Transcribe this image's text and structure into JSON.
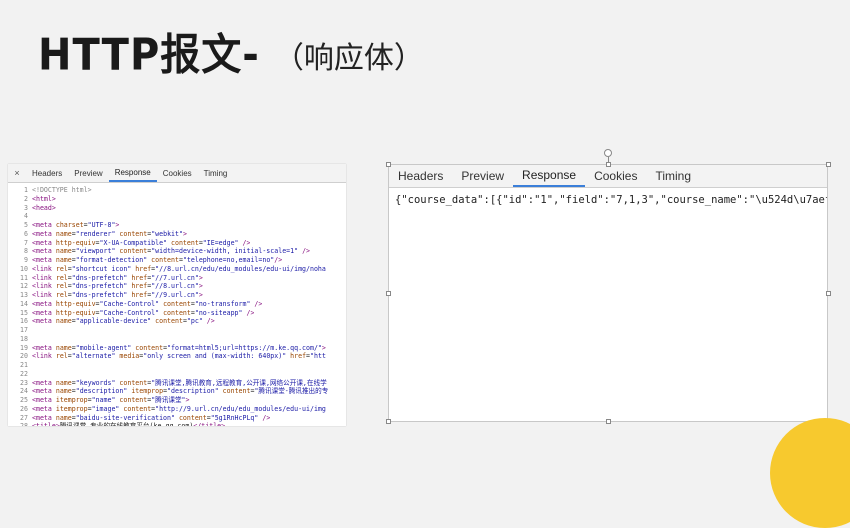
{
  "slide": {
    "title_main": "HTTP报文-",
    "title_sub": "（响应体）"
  },
  "left_panel": {
    "close_label": "×",
    "tabs": [
      "Headers",
      "Preview",
      "Response",
      "Cookies",
      "Timing"
    ],
    "active_tab": "Response",
    "lines": [
      {
        "n": "1",
        "t": "<!DOCTYPE html>"
      },
      {
        "n": "2",
        "t": "<html>"
      },
      {
        "n": "3",
        "t": "<head>"
      },
      {
        "n": "4",
        "t": ""
      },
      {
        "n": "5",
        "t": "<meta charset=\"UTF-8\">"
      },
      {
        "n": "6",
        "t": "<meta name=\"renderer\" content=\"webkit\">"
      },
      {
        "n": "7",
        "t": "<meta http-equiv=\"X-UA-Compatible\" content=\"IE=edge\" />"
      },
      {
        "n": "8",
        "t": "<meta name=\"viewport\" content=\"width=device-width, initial-scale=1\" />"
      },
      {
        "n": "9",
        "t": "<meta name=\"format-detection\" content=\"telephone=no,email=no\"/>"
      },
      {
        "n": "10",
        "t": "<link rel=\"shortcut icon\" href=\"//8.url.cn/edu/edu_modules/edu-ui/img/noha"
      },
      {
        "n": "11",
        "t": "<link rel=\"dns-prefetch\" href=\"//7.url.cn\">"
      },
      {
        "n": "12",
        "t": "<link rel=\"dns-prefetch\" href=\"//8.url.cn\">"
      },
      {
        "n": "13",
        "t": "<link rel=\"dns-prefetch\" href=\"//9.url.cn\">"
      },
      {
        "n": "14",
        "t": "<meta http-equiv=\"Cache-Control\" content=\"no-transform\" />"
      },
      {
        "n": "15",
        "t": "<meta http-equiv=\"Cache-Control\" content=\"no-siteapp\" />"
      },
      {
        "n": "16",
        "t": "<meta name=\"applicable-device\" content=\"pc\" />"
      },
      {
        "n": "17",
        "t": ""
      },
      {
        "n": "18",
        "t": ""
      },
      {
        "n": "19",
        "t": "<meta name=\"mobile-agent\" content=\"format=html5;url=https://m.ke.qq.com/\">"
      },
      {
        "n": "20",
        "t": "<link rel=\"alternate\" media=\"only screen and (max-width: 640px)\" href=\"htt"
      },
      {
        "n": "21",
        "t": ""
      },
      {
        "n": "22",
        "t": ""
      },
      {
        "n": "23",
        "t": "<meta name=\"keywords\" content=\"腾讯课堂,腾讯教育,远程教育,公开课,网络公开课,在线学"
      },
      {
        "n": "24",
        "t": "<meta name=\"description\" itemprop=\"description\" content=\"腾讯课堂-腾讯推出的专"
      },
      {
        "n": "25",
        "t": "<meta itemprop=\"name\" content=\"腾讯课堂\">"
      },
      {
        "n": "26",
        "t": "<meta itemprop=\"image\" content=\"http://9.url.cn/edu/edu_modules/edu-ui/img"
      },
      {
        "n": "27",
        "t": "<meta name=\"baidu-site-verification\" content=\"5g1RnHcPLq\" />"
      },
      {
        "n": "28",
        "t": "<title>腾讯课堂_专业的在线教育平台(ke.qq.com)</title>"
      },
      {
        "n": "29",
        "t": "<script>window.TRecord=window.TRecord||function(){var e={core:{grandDetail"
      }
    ]
  },
  "right_panel": {
    "tabs": [
      "Headers",
      "Preview",
      "Response",
      "Cookies",
      "Timing"
    ],
    "active_tab": "Response",
    "body": "{\"course_data\":[{\"id\":\"1\",\"field\":\"7,1,3\",\"course_name\":\"\\u524d\\u7aef\\u5f00\\"
  },
  "colors": {
    "accent_tab": "#3b7fd9",
    "corner_circle": "#f7c92e"
  }
}
